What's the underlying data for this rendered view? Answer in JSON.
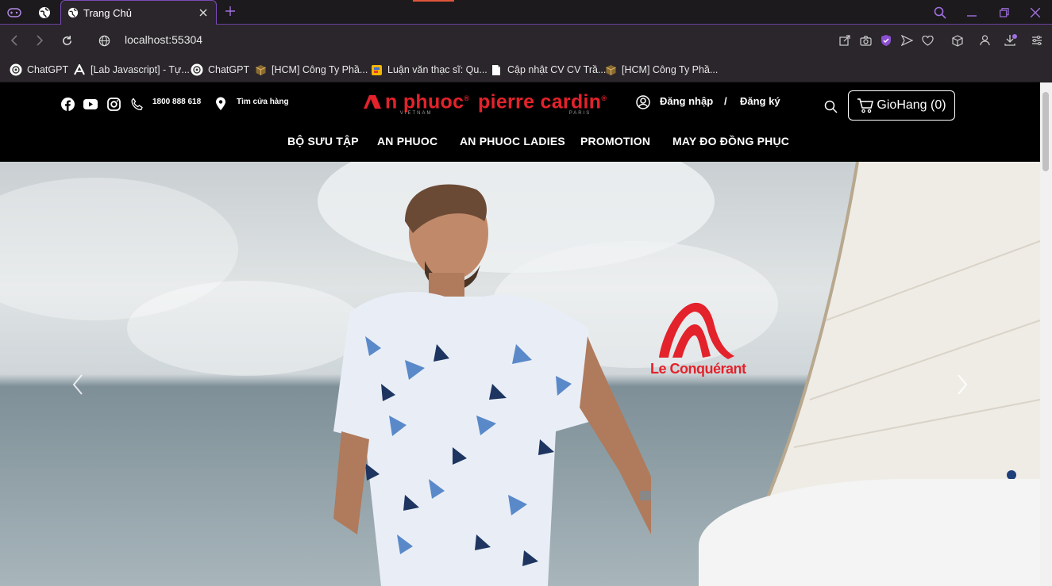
{
  "browser": {
    "tabs": [
      {
        "title": "Trang Chủ"
      }
    ],
    "url": "localhost:55304",
    "bookmarks": [
      {
        "label": "ChatGPT",
        "icon": "chatgpt-icon"
      },
      {
        "label": "[Lab Javascript] - Tự...",
        "icon": "letter-a-icon"
      },
      {
        "label": "ChatGPT",
        "icon": "chatgpt-icon"
      },
      {
        "label": "[HCM] Công Ty Phầ...",
        "icon": "box-icon"
      },
      {
        "label": "Luận văn thạc sĩ: Qu...",
        "icon": "doc-colored-icon"
      },
      {
        "label": "Cập nhật CV CV Trầ...",
        "icon": "file-icon"
      },
      {
        "label": "[HCM] Công Ty Phầ...",
        "icon": "box-icon"
      }
    ]
  },
  "site": {
    "phone": "1800 888 618",
    "store_locator": "Tìm cửa hàng",
    "logo_anphuoc": "An phuoc",
    "logo_anphuoc_sub": "VIETNAM",
    "logo_pierre": "pierre cardin",
    "logo_pierre_sub": "PARIS",
    "login": "Đăng nhập",
    "separator": "/",
    "register": "Đăng ký",
    "cart_label": "GioHang (0)",
    "menu": [
      {
        "label": "BỘ SƯU TẬP"
      },
      {
        "label": "AN PHUOC"
      },
      {
        "label": "AN PHUOC LADIES"
      },
      {
        "label": "PROMOTION"
      },
      {
        "label": "MAY ĐO ĐỒNG PHỤC"
      }
    ],
    "hero_brand": "Le Conquérant"
  },
  "colors": {
    "brand_red": "#e3222b",
    "browser_accent": "#8a4fd0"
  }
}
